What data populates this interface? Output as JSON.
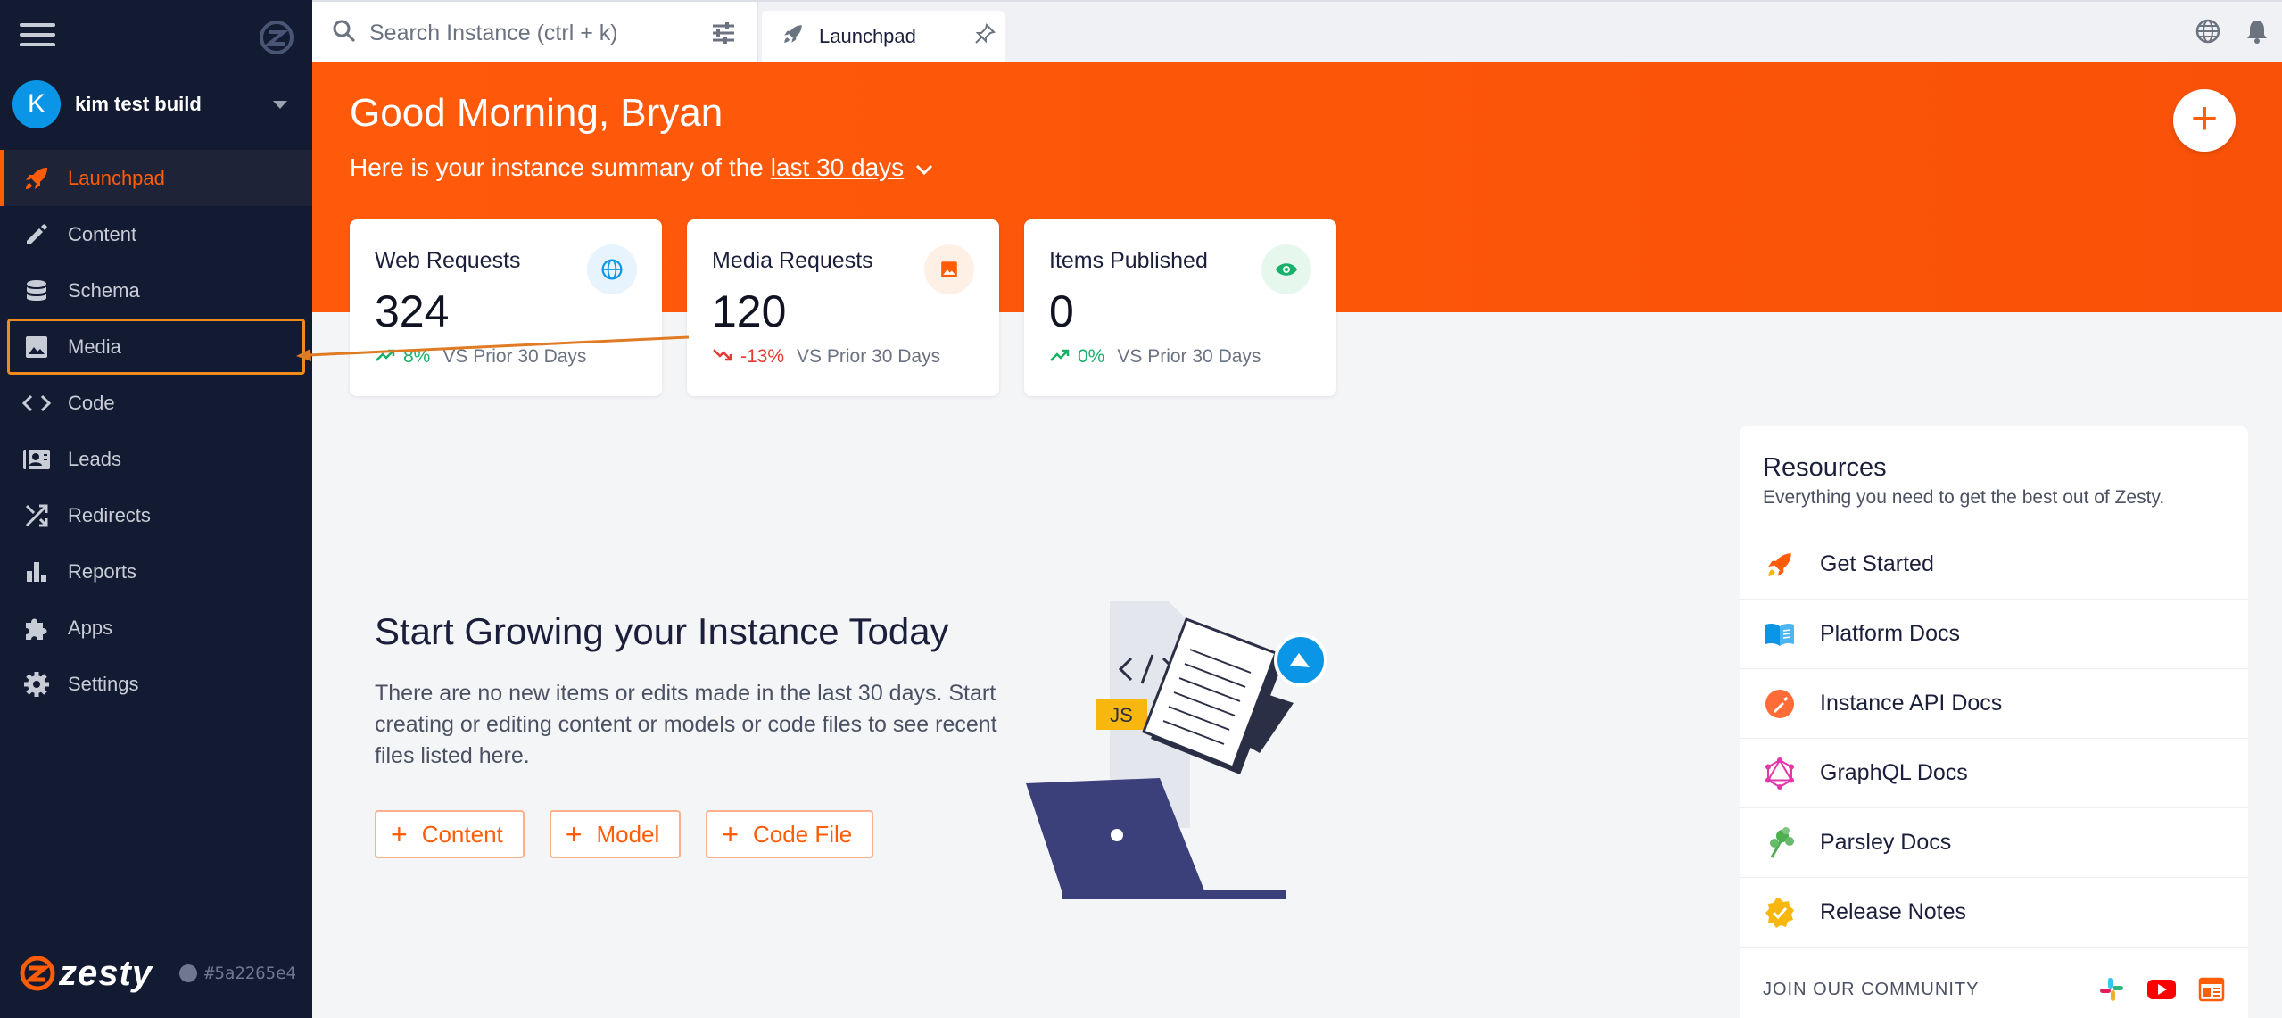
{
  "sidebar": {
    "instance_initial": "K",
    "instance_name": "kim test build",
    "items": [
      {
        "label": "Launchpad",
        "icon": "rocket-icon"
      },
      {
        "label": "Content",
        "icon": "pencil-icon"
      },
      {
        "label": "Schema",
        "icon": "database-icon"
      },
      {
        "label": "Media",
        "icon": "image-icon"
      },
      {
        "label": "Code",
        "icon": "code-icon"
      },
      {
        "label": "Leads",
        "icon": "contact-card-icon"
      },
      {
        "label": "Redirects",
        "icon": "shuffle-icon"
      },
      {
        "label": "Reports",
        "icon": "bar-chart-icon"
      },
      {
        "label": "Apps",
        "icon": "puzzle-icon"
      },
      {
        "label": "Settings",
        "icon": "gear-icon"
      }
    ],
    "brand": "zesty",
    "build_hash": "#5a2265e4"
  },
  "topbar": {
    "search_placeholder": "Search Instance (ctrl + k)",
    "tab_label": "Launchpad"
  },
  "hero": {
    "greeting": "Good Morning, Bryan",
    "summary_prefix": "Here is your instance summary of the",
    "summary_range": "last 30 days"
  },
  "metrics": [
    {
      "title": "Web Requests",
      "value": "324",
      "change": "8%",
      "direction": "up",
      "compare": "VS Prior 30 Days"
    },
    {
      "title": "Media Requests",
      "value": "120",
      "change": "-13%",
      "direction": "down",
      "compare": "VS Prior 30 Days"
    },
    {
      "title": "Items Published",
      "value": "0",
      "change": "0%",
      "direction": "up",
      "compare": "VS Prior 30 Days"
    }
  ],
  "empty_state": {
    "title": "Start Growing your Instance Today",
    "description": "There are no new items or edits made in the last 30 days. Start creating or editing content or models or code files to see recent files listed here.",
    "buttons": [
      "Content",
      "Model",
      "Code File"
    ],
    "illustration_tag": "JS"
  },
  "resources": {
    "title": "Resources",
    "subtitle": "Everything you need to get the best out of Zesty.",
    "items": [
      {
        "label": "Get Started",
        "icon": "rocket-icon"
      },
      {
        "label": "Platform Docs",
        "icon": "book-icon"
      },
      {
        "label": "Instance API Docs",
        "icon": "api-icon"
      },
      {
        "label": "GraphQL Docs",
        "icon": "graphql-icon"
      },
      {
        "label": "Parsley Docs",
        "icon": "parsley-icon"
      },
      {
        "label": "Release Notes",
        "icon": "verified-badge-icon"
      }
    ],
    "community_label": "JOIN OUR COMMUNITY"
  },
  "colors": {
    "accent": "#ff5c08",
    "sidebar_bg": "#121b31",
    "up": "#18b06a",
    "down": "#e53935",
    "highlight": "#f08a1e"
  }
}
